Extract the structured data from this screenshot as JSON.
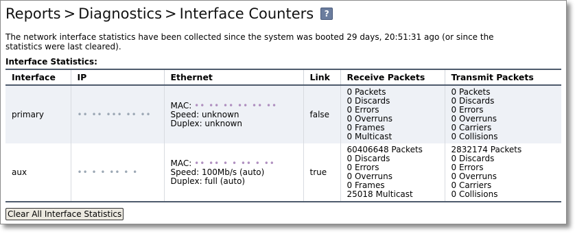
{
  "breadcrumb": {
    "items": [
      "Reports",
      "Diagnostics",
      "Interface Counters"
    ],
    "separator": ">",
    "help_icon": "help-icon",
    "help_label": "?"
  },
  "intro_text": "The network interface statistics have been collected since the system was booted 29 days, 20:51:31 ago (or since the statistics were last cleared).",
  "section_title": "Interface Statistics:",
  "table": {
    "headers": [
      "Interface",
      "IP",
      "Ethernet",
      "Link",
      "Receive Packets",
      "Transmit Packets"
    ],
    "rows": [
      {
        "interface": "primary",
        "ip": "•• •• ••• •• ••",
        "mac_label": "MAC:",
        "mac_value": "•• •• •• •• •• ••",
        "speed": "Speed: unknown",
        "duplex": "Duplex: unknown",
        "link": "false",
        "receive": [
          "0 Packets",
          "0 Discards",
          "0 Errors",
          "0 Overruns",
          "0 Frames",
          "0 Multicast"
        ],
        "transmit": [
          "0 Packets",
          "0 Discards",
          "0 Errors",
          "0 Overruns",
          "0 Carriers",
          "0 Collisions"
        ]
      },
      {
        "interface": "aux",
        "ip": "•• • • •• • •",
        "mac_label": "MAC:",
        "mac_value": "•• •• • • •• • ••",
        "speed": "Speed: 100Mb/s (auto)",
        "duplex": "Duplex: full (auto)",
        "link": "true",
        "receive": [
          "60406648 Packets",
          "0 Discards",
          "0 Errors",
          "0 Overruns",
          "0 Frames",
          "25018 Multicast"
        ],
        "transmit": [
          "2832174 Packets",
          "0 Discards",
          "0 Errors",
          "0 Overruns",
          "0 Carriers",
          "0 Collisions"
        ]
      }
    ]
  },
  "buttons": {
    "clear_all": "Clear All Interface Statistics"
  }
}
